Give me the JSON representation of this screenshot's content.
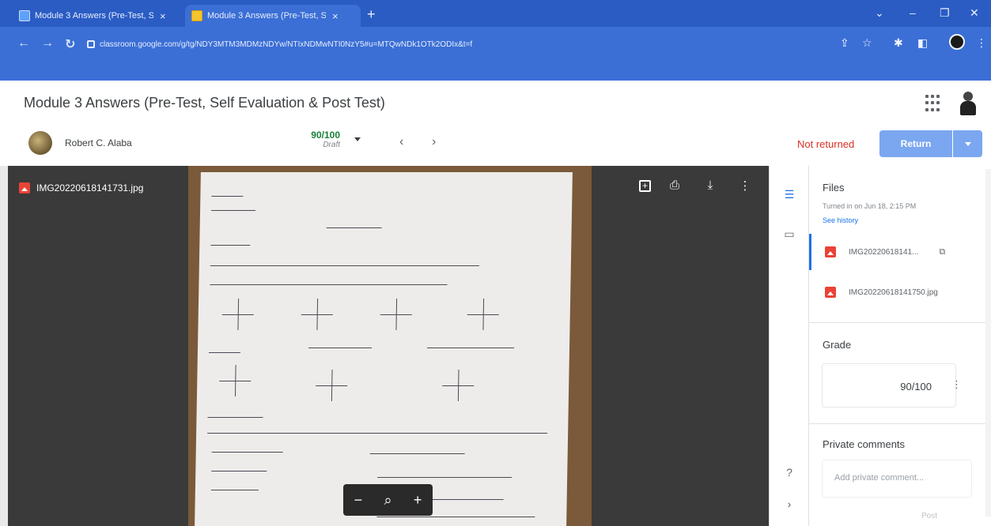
{
  "browser": {
    "tabs": [
      {
        "label": "Module 3 Answers (Pre-Test, Self",
        "close": "×"
      },
      {
        "label": "Module 3 Answers (Pre-Test, Self",
        "close": "×"
      }
    ],
    "new_tab": "+",
    "url": "classroom.google.com/g/tg/NDY3MTM3MDMzNDYw/NTIxNDMwNTI0NzY5#u=MTQwNDk1OTk2ODIx&t=f",
    "window_controls": {
      "chevron": "⌄",
      "minimize": "–",
      "restore": "❐",
      "close": "✕"
    }
  },
  "header": {
    "title": "Module 3 Answers (Pre-Test, Self Evaluation & Post Test)"
  },
  "student": {
    "name": "Robert C. Alaba",
    "grade": "90/100",
    "grade_state": "Draft",
    "status": "Not returned",
    "return_label": "Return"
  },
  "viewer": {
    "file_name": "IMG20220618141731.jpg"
  },
  "panel": {
    "files_heading": "Files",
    "turned_in": "Turned in on Jun 18, 2:15 PM",
    "see_history": "See history",
    "files": [
      {
        "name": "IMG20220618141..."
      },
      {
        "name": "IMG20220618141750.jpg"
      }
    ],
    "grade_heading": "Grade",
    "grade_value": "90/100",
    "private_heading": "Private comments",
    "comment_placeholder": "Add private comment...",
    "post_label": "Post"
  },
  "colors": {
    "chrome_blue": "#3b6fd6",
    "grade_green": "#188038",
    "status_red": "#d93025",
    "return_blue": "#7aa7f0"
  }
}
